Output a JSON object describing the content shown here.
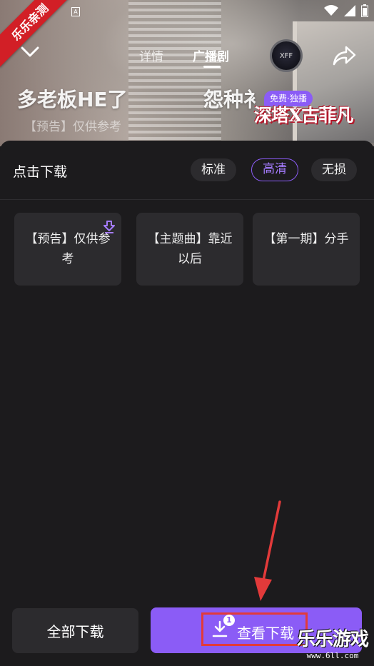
{
  "overlay": {
    "corner_ribbon": "乐乐亲测",
    "watermark_main": "乐乐游戏",
    "watermark_url": "www.6ll.com"
  },
  "status_bar": {
    "a_icon": "A",
    "icons": [
      "wifi-icon",
      "signal-icon",
      "battery-icon"
    ]
  },
  "header": {
    "tabs": [
      {
        "label": "详情",
        "active": false
      },
      {
        "label": "广播剧",
        "active": true
      }
    ],
    "avatar_text": "XFF",
    "icons": [
      "chevron-down-icon",
      "share-icon"
    ]
  },
  "banner": {
    "title_left": "多老板HE了",
    "title_right": "怨种衤",
    "badge": "免费·独播",
    "promo_title": "深塔X古菲凡",
    "subtitle": "【预告】仅供参考"
  },
  "sheet": {
    "title": "点击下载",
    "quality_options": [
      {
        "label": "标准",
        "selected": false
      },
      {
        "label": "高清",
        "selected": true
      },
      {
        "label": "无损",
        "selected": false
      }
    ],
    "episodes": [
      {
        "label": "【预告】仅供参考",
        "downloading": true
      },
      {
        "label": "【主题曲】靠近以后",
        "downloading": false
      },
      {
        "label": "【第一期】分手",
        "downloading": false
      }
    ],
    "download_all_label": "全部下载",
    "view_downloads_label": "查看下载",
    "download_count": "1"
  },
  "colors": {
    "accent": "#8b5cf6",
    "sheet_bg": "#1c1b1d",
    "card_bg": "#2c2b2e",
    "highlight": "#e23a3a"
  }
}
